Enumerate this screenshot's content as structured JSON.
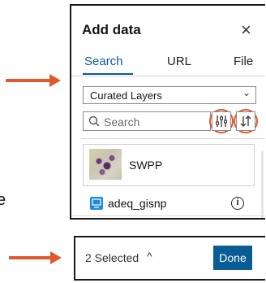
{
  "side_text": "e",
  "panel": {
    "title": "Add data",
    "tabs": [
      {
        "label": "Search",
        "active": true
      },
      {
        "label": "URL",
        "active": false
      },
      {
        "label": "File",
        "active": false
      }
    ],
    "source_select": {
      "value": "Curated Layers"
    },
    "search": {
      "placeholder": "Search"
    },
    "filter_icon": "sliders-icon",
    "sort_icon": "sort-icon",
    "results": [
      {
        "title": "SWPP",
        "type": "map-thumbnail"
      },
      {
        "title": "adeq_gisnp",
        "type": "layer",
        "icon": "layer-icon"
      }
    ]
  },
  "footer": {
    "selected_label": "2 Selected",
    "done_label": "Done"
  },
  "colors": {
    "accent": "#0a5c94",
    "highlight": "#e2572b"
  }
}
